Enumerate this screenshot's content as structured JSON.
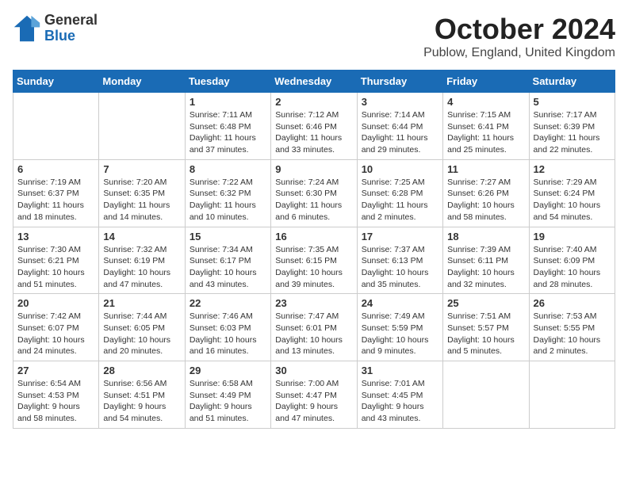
{
  "header": {
    "logo_general": "General",
    "logo_blue": "Blue",
    "month": "October 2024",
    "location": "Publow, England, United Kingdom"
  },
  "days_of_week": [
    "Sunday",
    "Monday",
    "Tuesday",
    "Wednesday",
    "Thursday",
    "Friday",
    "Saturday"
  ],
  "weeks": [
    [
      {
        "day": "",
        "info": ""
      },
      {
        "day": "",
        "info": ""
      },
      {
        "day": "1",
        "info": "Sunrise: 7:11 AM\nSunset: 6:48 PM\nDaylight: 11 hours\nand 37 minutes."
      },
      {
        "day": "2",
        "info": "Sunrise: 7:12 AM\nSunset: 6:46 PM\nDaylight: 11 hours\nand 33 minutes."
      },
      {
        "day": "3",
        "info": "Sunrise: 7:14 AM\nSunset: 6:44 PM\nDaylight: 11 hours\nand 29 minutes."
      },
      {
        "day": "4",
        "info": "Sunrise: 7:15 AM\nSunset: 6:41 PM\nDaylight: 11 hours\nand 25 minutes."
      },
      {
        "day": "5",
        "info": "Sunrise: 7:17 AM\nSunset: 6:39 PM\nDaylight: 11 hours\nand 22 minutes."
      }
    ],
    [
      {
        "day": "6",
        "info": "Sunrise: 7:19 AM\nSunset: 6:37 PM\nDaylight: 11 hours\nand 18 minutes."
      },
      {
        "day": "7",
        "info": "Sunrise: 7:20 AM\nSunset: 6:35 PM\nDaylight: 11 hours\nand 14 minutes."
      },
      {
        "day": "8",
        "info": "Sunrise: 7:22 AM\nSunset: 6:32 PM\nDaylight: 11 hours\nand 10 minutes."
      },
      {
        "day": "9",
        "info": "Sunrise: 7:24 AM\nSunset: 6:30 PM\nDaylight: 11 hours\nand 6 minutes."
      },
      {
        "day": "10",
        "info": "Sunrise: 7:25 AM\nSunset: 6:28 PM\nDaylight: 11 hours\nand 2 minutes."
      },
      {
        "day": "11",
        "info": "Sunrise: 7:27 AM\nSunset: 6:26 PM\nDaylight: 10 hours\nand 58 minutes."
      },
      {
        "day": "12",
        "info": "Sunrise: 7:29 AM\nSunset: 6:24 PM\nDaylight: 10 hours\nand 54 minutes."
      }
    ],
    [
      {
        "day": "13",
        "info": "Sunrise: 7:30 AM\nSunset: 6:21 PM\nDaylight: 10 hours\nand 51 minutes."
      },
      {
        "day": "14",
        "info": "Sunrise: 7:32 AM\nSunset: 6:19 PM\nDaylight: 10 hours\nand 47 minutes."
      },
      {
        "day": "15",
        "info": "Sunrise: 7:34 AM\nSunset: 6:17 PM\nDaylight: 10 hours\nand 43 minutes."
      },
      {
        "day": "16",
        "info": "Sunrise: 7:35 AM\nSunset: 6:15 PM\nDaylight: 10 hours\nand 39 minutes."
      },
      {
        "day": "17",
        "info": "Sunrise: 7:37 AM\nSunset: 6:13 PM\nDaylight: 10 hours\nand 35 minutes."
      },
      {
        "day": "18",
        "info": "Sunrise: 7:39 AM\nSunset: 6:11 PM\nDaylight: 10 hours\nand 32 minutes."
      },
      {
        "day": "19",
        "info": "Sunrise: 7:40 AM\nSunset: 6:09 PM\nDaylight: 10 hours\nand 28 minutes."
      }
    ],
    [
      {
        "day": "20",
        "info": "Sunrise: 7:42 AM\nSunset: 6:07 PM\nDaylight: 10 hours\nand 24 minutes."
      },
      {
        "day": "21",
        "info": "Sunrise: 7:44 AM\nSunset: 6:05 PM\nDaylight: 10 hours\nand 20 minutes."
      },
      {
        "day": "22",
        "info": "Sunrise: 7:46 AM\nSunset: 6:03 PM\nDaylight: 10 hours\nand 16 minutes."
      },
      {
        "day": "23",
        "info": "Sunrise: 7:47 AM\nSunset: 6:01 PM\nDaylight: 10 hours\nand 13 minutes."
      },
      {
        "day": "24",
        "info": "Sunrise: 7:49 AM\nSunset: 5:59 PM\nDaylight: 10 hours\nand 9 minutes."
      },
      {
        "day": "25",
        "info": "Sunrise: 7:51 AM\nSunset: 5:57 PM\nDaylight: 10 hours\nand 5 minutes."
      },
      {
        "day": "26",
        "info": "Sunrise: 7:53 AM\nSunset: 5:55 PM\nDaylight: 10 hours\nand 2 minutes."
      }
    ],
    [
      {
        "day": "27",
        "info": "Sunrise: 6:54 AM\nSunset: 4:53 PM\nDaylight: 9 hours\nand 58 minutes."
      },
      {
        "day": "28",
        "info": "Sunrise: 6:56 AM\nSunset: 4:51 PM\nDaylight: 9 hours\nand 54 minutes."
      },
      {
        "day": "29",
        "info": "Sunrise: 6:58 AM\nSunset: 4:49 PM\nDaylight: 9 hours\nand 51 minutes."
      },
      {
        "day": "30",
        "info": "Sunrise: 7:00 AM\nSunset: 4:47 PM\nDaylight: 9 hours\nand 47 minutes."
      },
      {
        "day": "31",
        "info": "Sunrise: 7:01 AM\nSunset: 4:45 PM\nDaylight: 9 hours\nand 43 minutes."
      },
      {
        "day": "",
        "info": ""
      },
      {
        "day": "",
        "info": ""
      }
    ]
  ]
}
